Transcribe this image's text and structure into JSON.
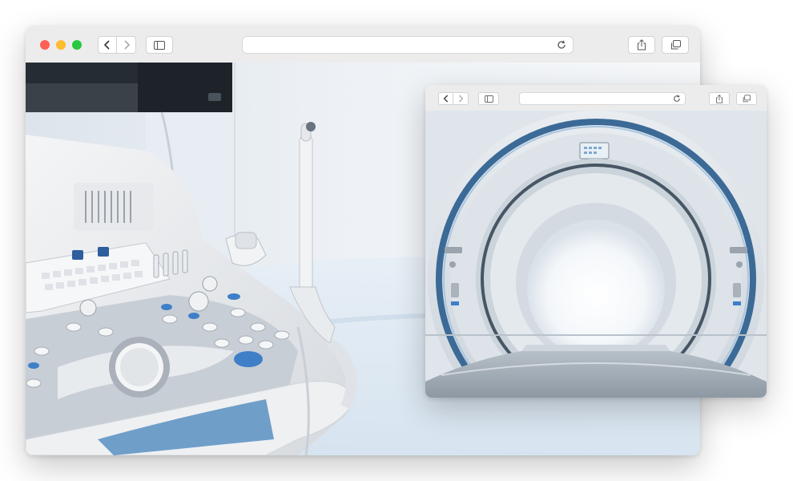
{
  "back_window": {
    "url": "",
    "traffic_lights": {
      "close": "#ff5f57",
      "minimize": "#febc2e",
      "zoom": "#28c840"
    },
    "icons": {
      "back": "chevron-left-icon",
      "forward": "chevron-right-icon",
      "sidebar": "sidebar-icon",
      "reload": "reload-icon",
      "share": "share-icon",
      "tabs": "tabs-icon"
    },
    "image": {
      "subject": "ultrasound-machine"
    }
  },
  "front_window": {
    "url": "",
    "icons": {
      "back": "chevron-left-icon",
      "forward": "chevron-right-icon",
      "sidebar": "sidebar-icon",
      "reload": "reload-icon",
      "share": "share-icon",
      "tabs": "tabs-icon"
    },
    "image": {
      "subject": "mri-scanner"
    }
  },
  "colors": {
    "toolbar": "#ececec",
    "accent_blue": "#3f7fc8",
    "device_white": "#f2f4f6"
  }
}
